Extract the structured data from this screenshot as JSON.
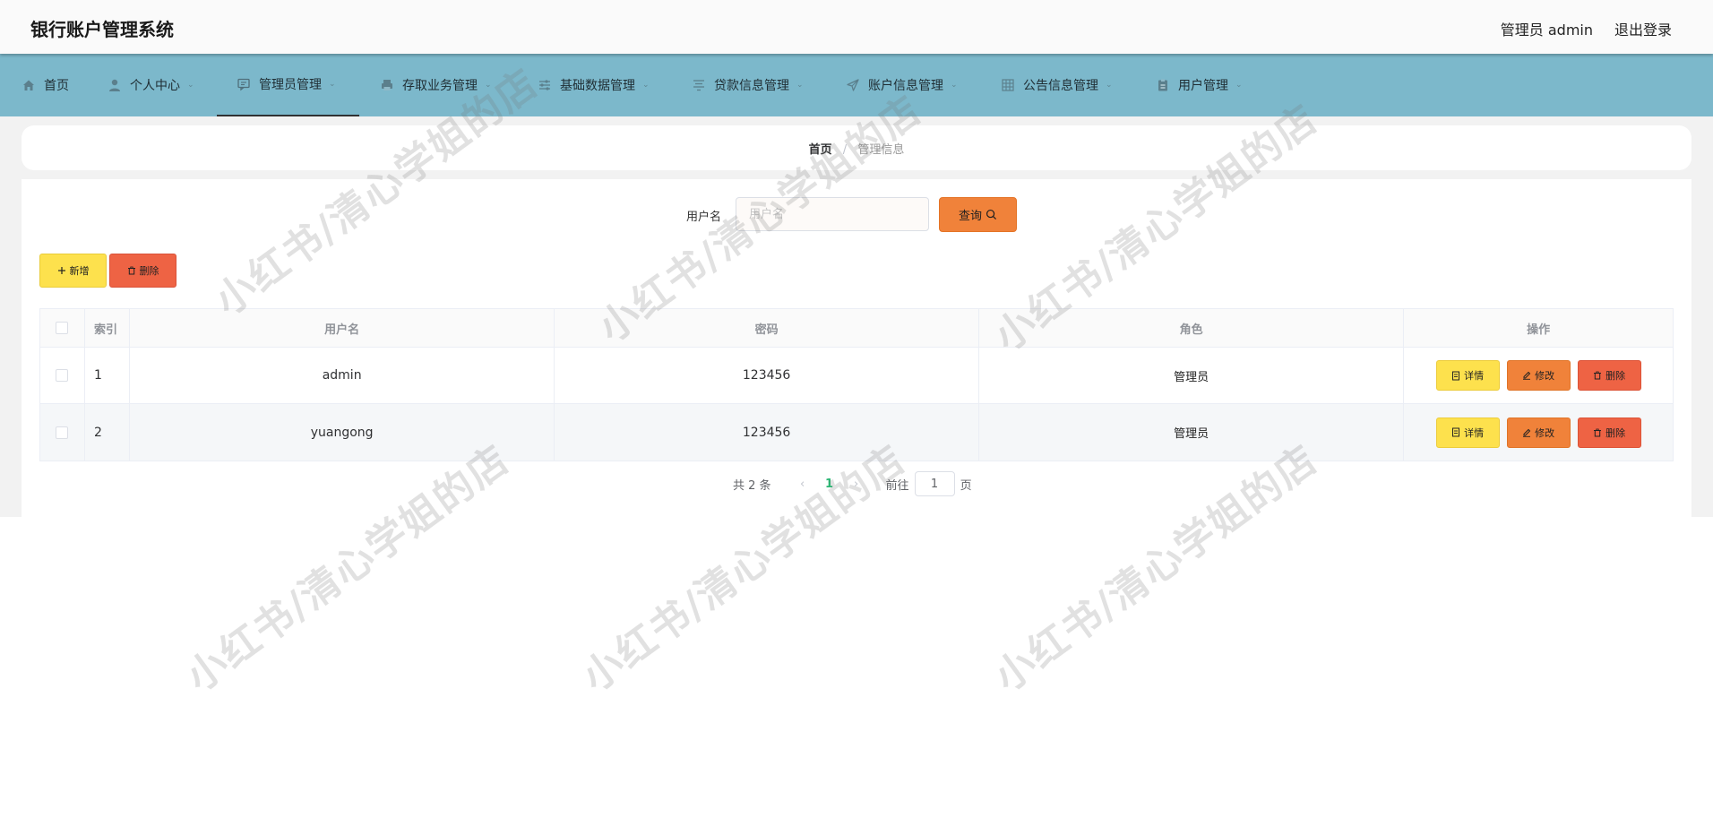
{
  "app": {
    "title": "银行账户管理系统",
    "user_info": "管理员 admin",
    "logout_label": "退出登录"
  },
  "nav": {
    "items": [
      {
        "label": "首页",
        "icon": "home-icon"
      },
      {
        "label": "个人中心",
        "icon": "user-icon"
      },
      {
        "label": "管理员管理",
        "icon": "chat-icon",
        "active": true
      },
      {
        "label": "存取业务管理",
        "icon": "printer-icon"
      },
      {
        "label": "基础数据管理",
        "icon": "sliders-icon"
      },
      {
        "label": "贷款信息管理",
        "icon": "filter-icon"
      },
      {
        "label": "账户信息管理",
        "icon": "send-icon"
      },
      {
        "label": "公告信息管理",
        "icon": "grid-icon"
      },
      {
        "label": "用户管理",
        "icon": "clipboard-icon"
      }
    ]
  },
  "breadcrumb": {
    "home": "首页",
    "separator": "/",
    "current": "管理信息"
  },
  "search": {
    "label": "用户名",
    "placeholder": "用户名",
    "value": "",
    "button_label": "查询"
  },
  "toolbar": {
    "add_label": "新增",
    "delete_label": "删除"
  },
  "table": {
    "columns": [
      "索引",
      "用户名",
      "密码",
      "角色",
      "操作"
    ],
    "rows": [
      {
        "index": "1",
        "username": "admin",
        "password": "123456",
        "role": "管理员"
      },
      {
        "index": "2",
        "username": "yuangong",
        "password": "123456",
        "role": "管理员"
      }
    ],
    "actions": {
      "detail": "详情",
      "edit": "修改",
      "delete": "删除"
    }
  },
  "pagination": {
    "total_text": "共 2 条",
    "current_page": "1",
    "goto_label": "前往",
    "goto_value": "1",
    "page_suffix": "页"
  },
  "watermark": {
    "text": "小红书/清心学姐的店"
  },
  "colors": {
    "nav_bg": "#7cb8cb",
    "primary_orange": "#f0823a",
    "yellow": "#fde14d",
    "red": "#ee6344",
    "active_page": "#2bb673"
  }
}
